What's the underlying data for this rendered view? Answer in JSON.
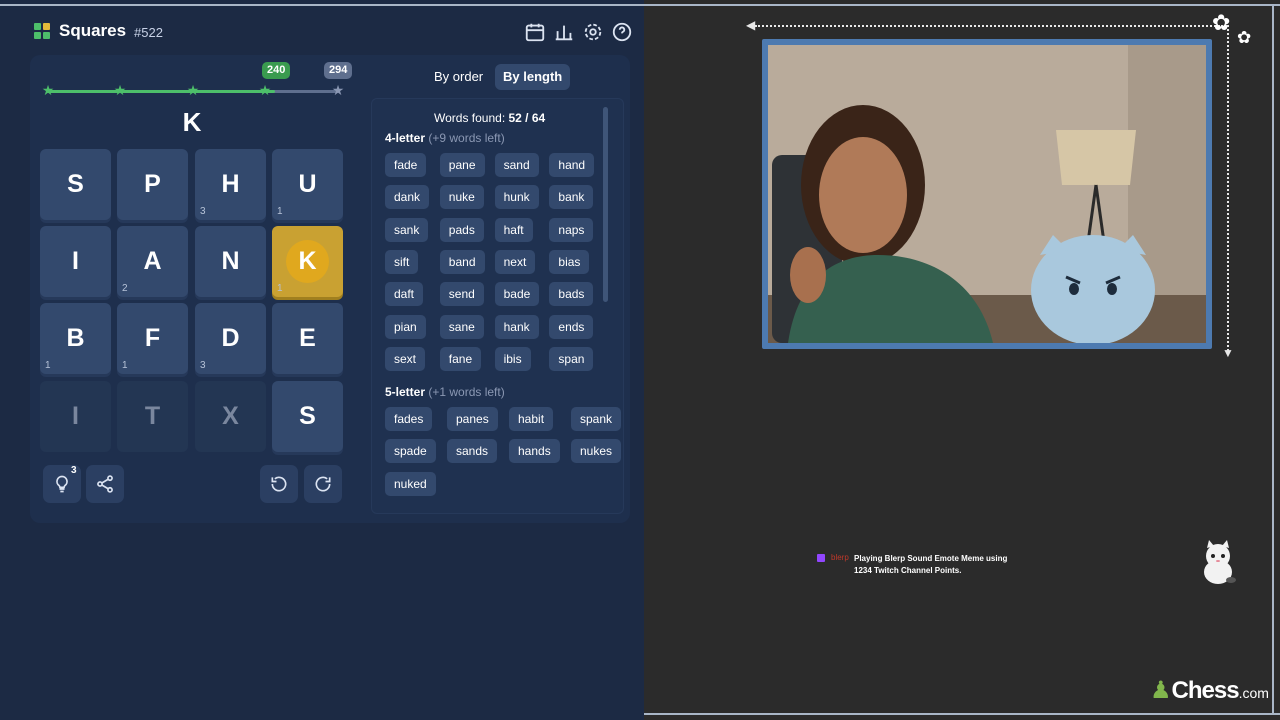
{
  "app": {
    "title": "Squares",
    "puzzle_number": "#522",
    "accent": "#4dbf6a",
    "header_icons": [
      "calendar-icon",
      "stats-icon",
      "settings-icon",
      "help-icon"
    ]
  },
  "progress": {
    "badges": [
      {
        "value": "240",
        "color": "#3a9b4f"
      },
      {
        "value": "294",
        "color": "#5f6f8e"
      }
    ],
    "stars_total": 5,
    "stars_reached": 4,
    "fill_fraction": 0.78
  },
  "current_word": "K",
  "grid": [
    {
      "letter": "S",
      "count": "",
      "state": "normal"
    },
    {
      "letter": "P",
      "count": "",
      "state": "normal"
    },
    {
      "letter": "H",
      "count": "3",
      "state": "normal"
    },
    {
      "letter": "U",
      "count": "1",
      "state": "normal"
    },
    {
      "letter": "I",
      "count": "",
      "state": "normal"
    },
    {
      "letter": "A",
      "count": "2",
      "state": "normal"
    },
    {
      "letter": "N",
      "count": "",
      "state": "normal"
    },
    {
      "letter": "K",
      "count": "1",
      "state": "selected"
    },
    {
      "letter": "B",
      "count": "1",
      "state": "normal"
    },
    {
      "letter": "F",
      "count": "1",
      "state": "normal"
    },
    {
      "letter": "D",
      "count": "3",
      "state": "normal"
    },
    {
      "letter": "E",
      "count": "",
      "state": "normal"
    },
    {
      "letter": "I",
      "count": "",
      "state": "used"
    },
    {
      "letter": "T",
      "count": "",
      "state": "used"
    },
    {
      "letter": "X",
      "count": "",
      "state": "used"
    },
    {
      "letter": "S",
      "count": "",
      "state": "normal"
    }
  ],
  "controls": {
    "hint_count": "3",
    "icons": [
      "hint-icon",
      "share-icon",
      "undo-icon",
      "redo-icon"
    ]
  },
  "word_list": {
    "tab_by_order": "By order",
    "tab_by_length": "By length",
    "found_label": "Words found:",
    "found_value": "52 / 64",
    "sections": [
      {
        "title": "4-letter",
        "remaining": "(+9 words left)",
        "words": [
          "fade",
          "pane",
          "sand",
          "hand",
          "dank",
          "nuke",
          "hunk",
          "bank",
          "sank",
          "pads",
          "haft",
          "naps",
          "sift",
          "band",
          "next",
          "bias",
          "daft",
          "send",
          "bade",
          "bads",
          "pian",
          "sane",
          "hank",
          "ends",
          "sext",
          "fane",
          "ibis",
          "span"
        ]
      },
      {
        "title": "5-letter",
        "remaining": "(+1 words left)",
        "words": [
          "fades",
          "panes",
          "habit",
          "spank",
          "spade",
          "sands",
          "hands",
          "nukes",
          "nuked"
        ]
      }
    ]
  },
  "stream": {
    "alert_user": "blerp",
    "alert_text": "Playing Blerp Sound Emote Meme using 1234 Twitch Channel Points.",
    "brand": "Chess",
    "brand_suffix": ".com"
  }
}
